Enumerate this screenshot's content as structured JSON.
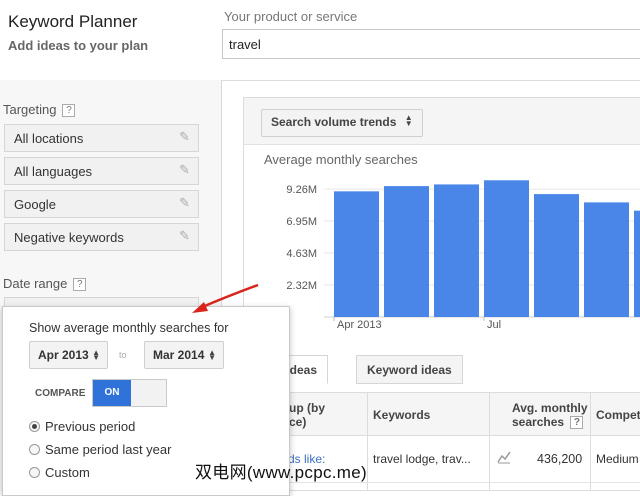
{
  "header": {
    "app_title": "Keyword Planner",
    "subtitle": "Add ideas to your plan",
    "product_label": "Your product or service",
    "product_value": "travel"
  },
  "targeting": {
    "label": "Targeting",
    "help": "?",
    "items": [
      {
        "label": "All locations"
      },
      {
        "label": "All languages"
      },
      {
        "label": "Google"
      },
      {
        "label": "Negative keywords"
      }
    ]
  },
  "date_range": {
    "label": "Date range",
    "help": "?"
  },
  "chart_controls": {
    "trend_dropdown": "Search volume trends"
  },
  "chart_data": {
    "type": "bar",
    "title": "Average monthly searches",
    "yticks": [
      "9.26M",
      "6.95M",
      "4.63M",
      "2.32M"
    ],
    "ytick_values": [
      9.26,
      6.95,
      4.63,
      2.32
    ],
    "xticks": [
      {
        "label": "Apr 2013",
        "index": 0
      },
      {
        "label": "Jul",
        "index": 3
      }
    ],
    "ylim": [
      0,
      10.5
    ],
    "values": [
      9.1,
      9.48,
      9.6,
      9.9,
      8.9,
      8.3,
      7.7
    ],
    "color": "#4a86e8"
  },
  "tabs": [
    {
      "label": "oup ideas"
    },
    {
      "label": "Keyword ideas"
    }
  ],
  "table": {
    "columns": [
      {
        "line1": "up (by",
        "line2": "ce)"
      },
      {
        "line1": "Keywords",
        "line2": ""
      },
      {
        "line1": "Avg. monthly",
        "line2": "searches"
      },
      {
        "line1": "Compet",
        "line2": ""
      }
    ],
    "searches_help": "?",
    "rows": [
      {
        "group": "rds like:",
        "keywords": "travel lodge, trav...",
        "searches": "436,200",
        "competition": "Medium"
      }
    ]
  },
  "popup": {
    "title": "Show average monthly searches for",
    "from": "Apr 2013",
    "to_text": "to",
    "to": "Mar 2014",
    "compare_label": "COMPARE",
    "toggle_on": "ON",
    "options": [
      {
        "label": "Previous period",
        "checked": true
      },
      {
        "label": "Same period last year",
        "checked": false
      },
      {
        "label": "Custom",
        "checked": false
      }
    ]
  },
  "watermark": "双电网(www.pcpc.me)",
  "colors": {
    "accent": "#2f73da",
    "bar": "#4a86e8",
    "arrow": "#d9241c",
    "link": "#3a6fc4"
  }
}
